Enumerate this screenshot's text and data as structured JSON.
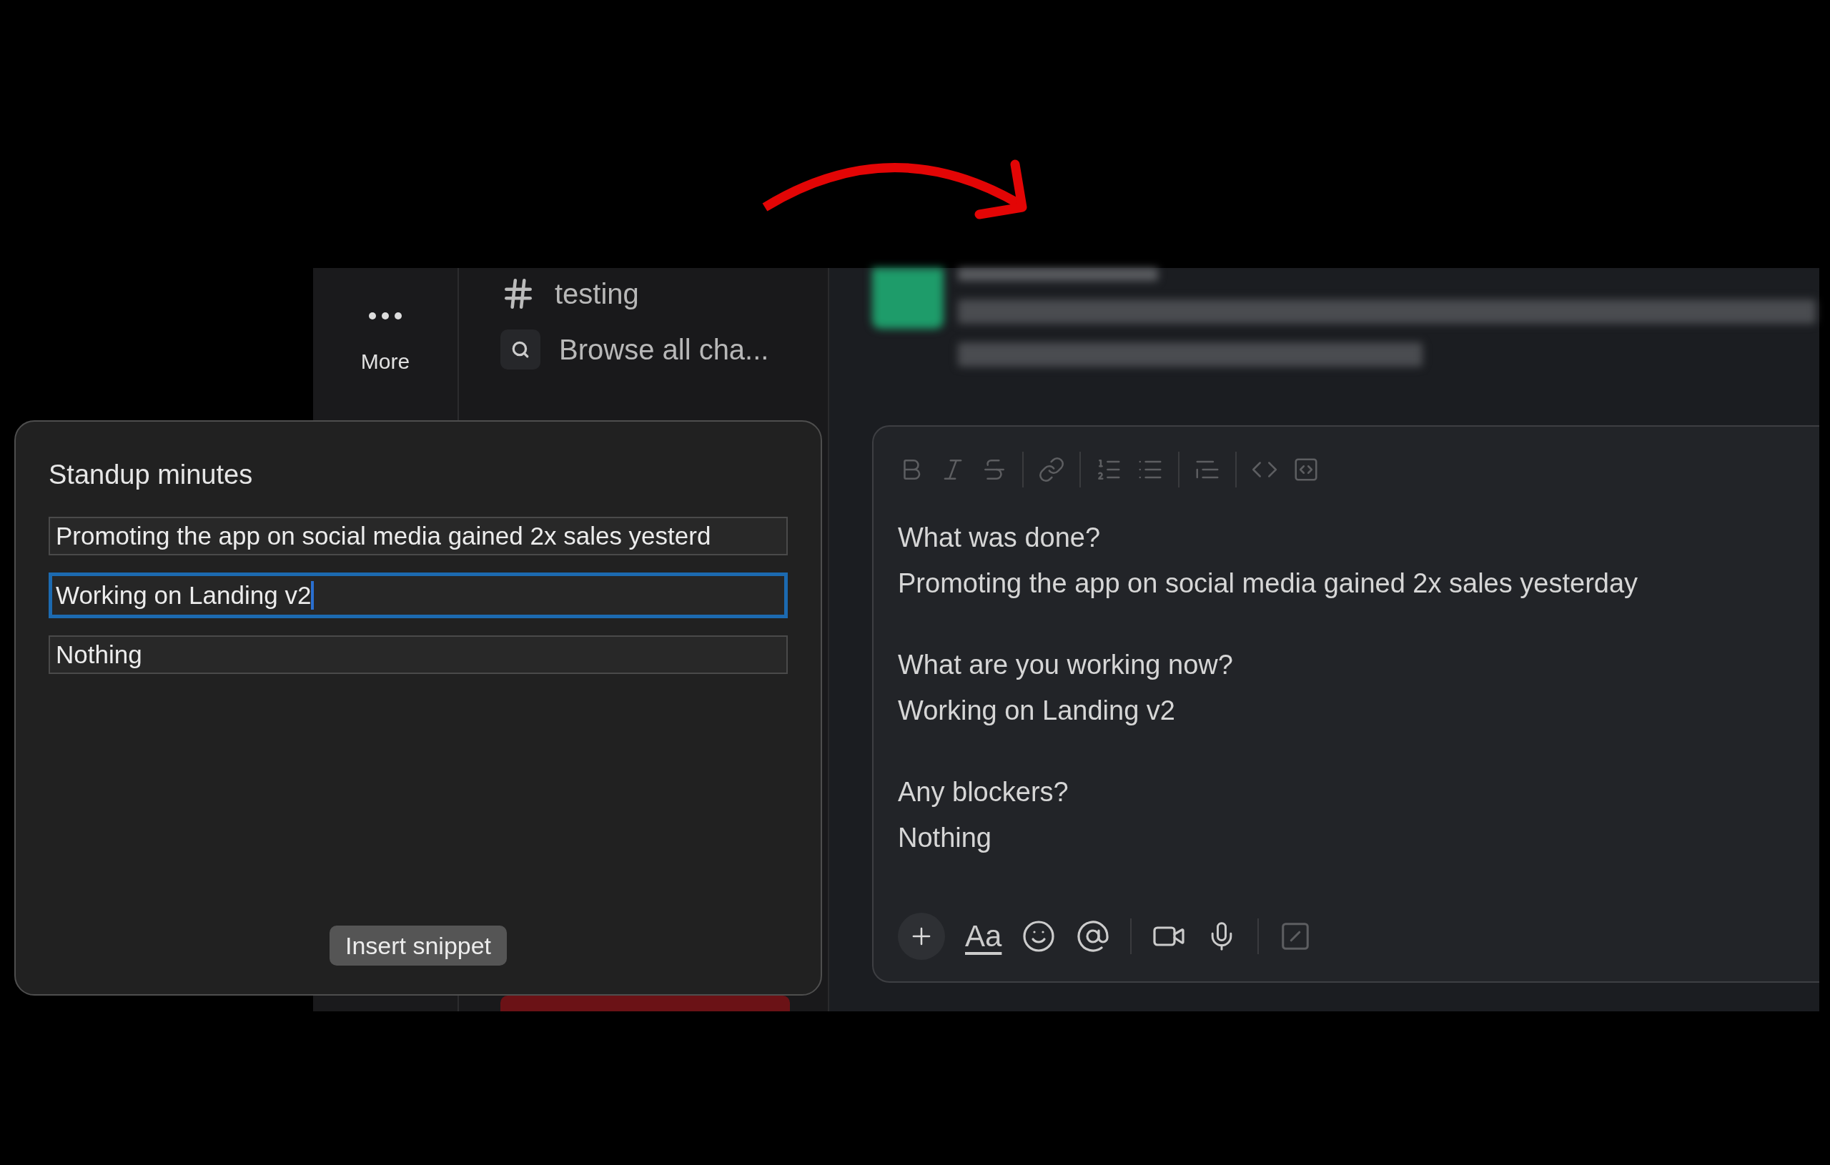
{
  "rail": {
    "more_label": "More"
  },
  "channels": [
    {
      "kind": "channel",
      "label": "testing"
    },
    {
      "kind": "browse",
      "label": "Browse all cha..."
    }
  ],
  "snippet_popup": {
    "title": "Standup minutes",
    "fields": [
      {
        "value": "Promoting the app on social media gained 2x sales yesterd",
        "focused": false
      },
      {
        "value": "Working on Landing v2",
        "focused": true
      },
      {
        "value": "Nothing",
        "focused": false
      }
    ],
    "button": "Insert snippet"
  },
  "composer": {
    "blocks": [
      {
        "question": "What was done?",
        "answer": "Promoting the app on social media gained 2x sales yesterday"
      },
      {
        "question": "What are you working now?",
        "answer": "Working on Landing v2"
      },
      {
        "question": "Any blockers?",
        "answer": "Nothing"
      }
    ],
    "format_label": "Aa"
  }
}
